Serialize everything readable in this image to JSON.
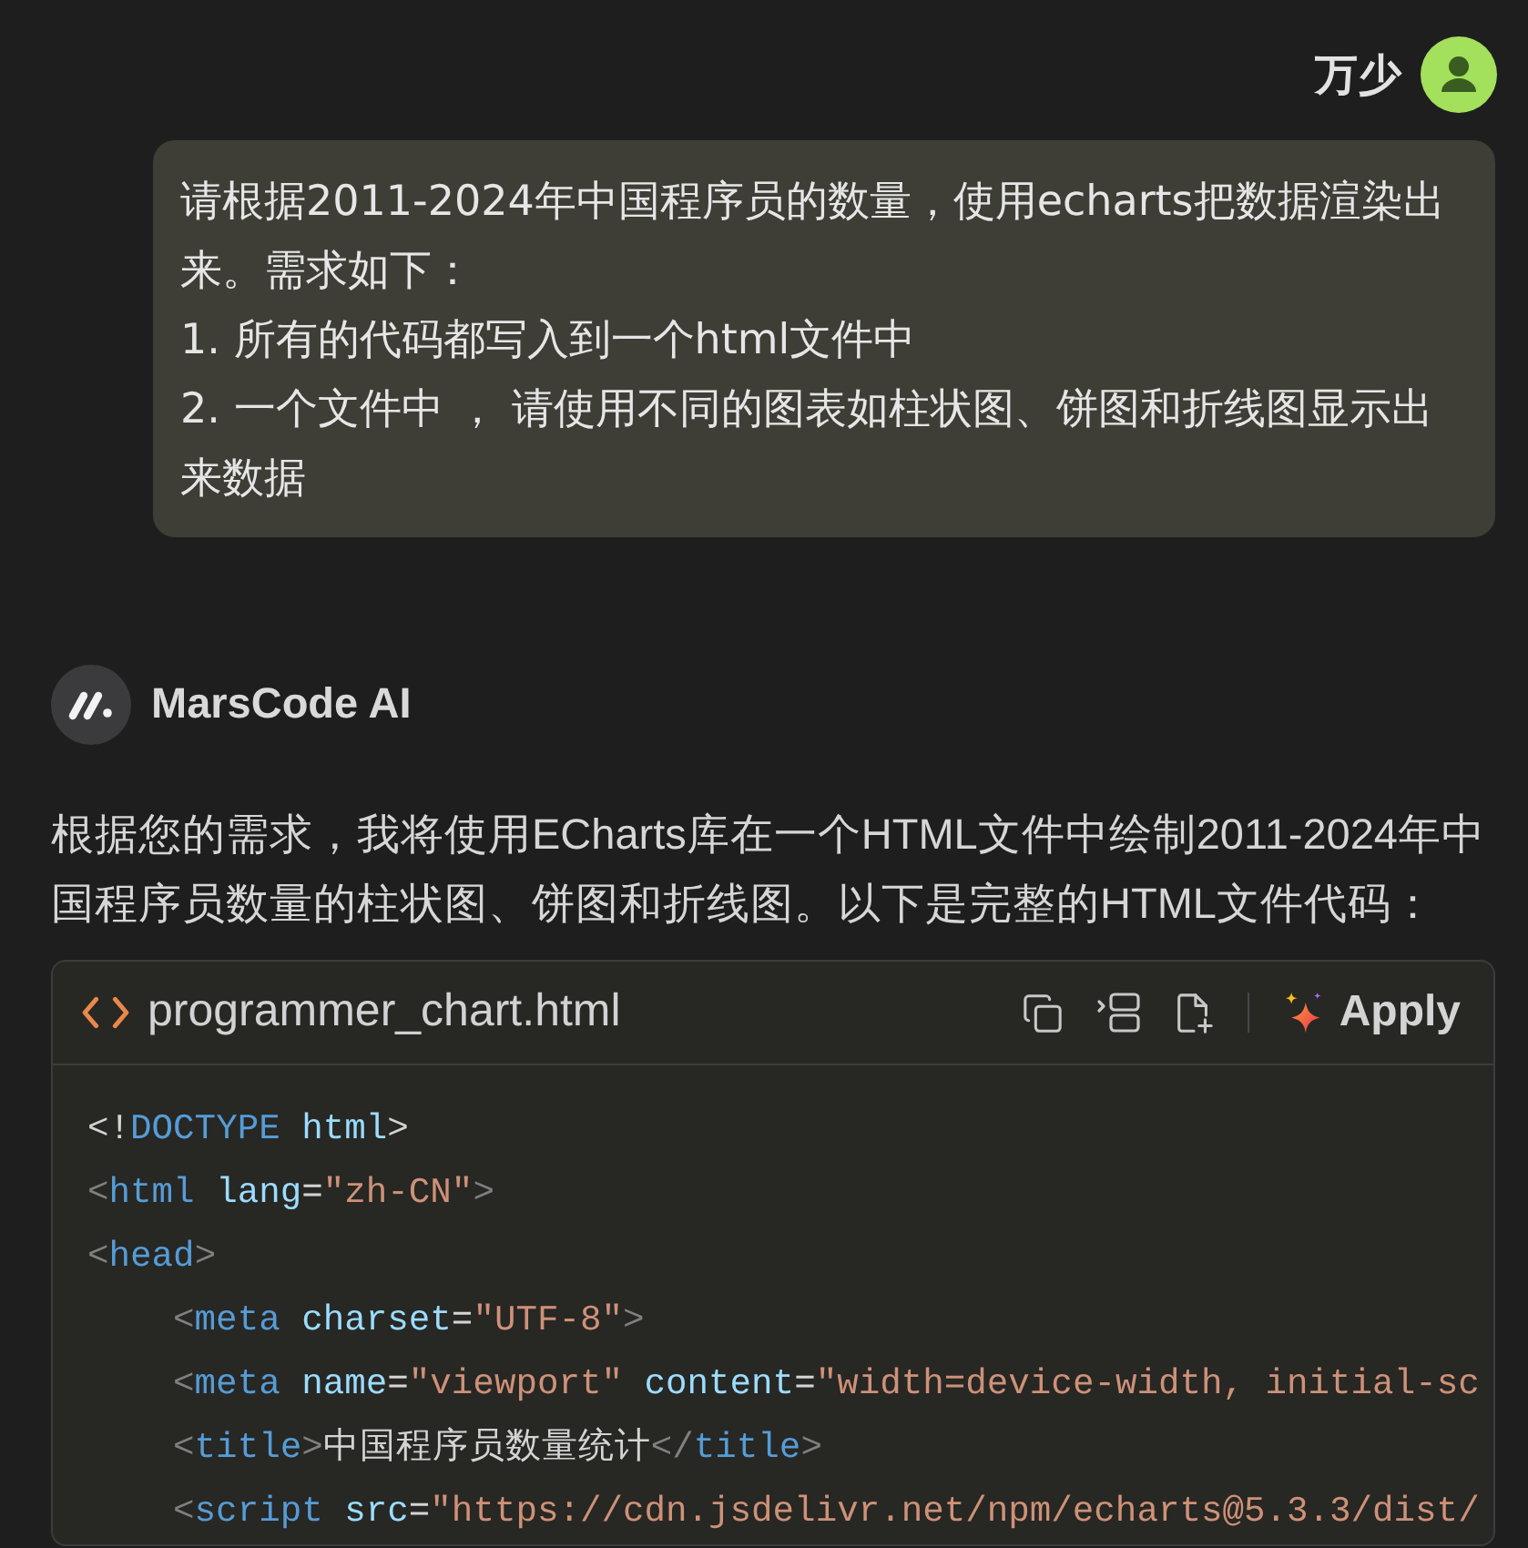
{
  "user_message": {
    "author": "万少",
    "paragraphs": [
      "请根据2011-2024年中国程序员的数量，使用echarts把数据渲染出来。需求如下：",
      "1. 所有的代码都写入到一个html文件中",
      "2. 一个文件中 ， 请使用不同的图表如柱状图、饼图和折线图显示出来数据"
    ]
  },
  "assistant_message": {
    "author": "MarsCode AI",
    "text": "根据您的需求，我将使用ECharts库在一个HTML文件中绘制2011-2024年中国程序员数量的柱状图、饼图和折线图。以下是完整的HTML文件代码：",
    "code_block": {
      "filename": "programmer_chart.html",
      "apply_label": "Apply",
      "lines": [
        {
          "tokens": [
            {
              "kind": "text",
              "text": "<!"
            },
            {
              "kind": "tag",
              "text": "DOCTYPE"
            },
            {
              "kind": "attr",
              "text": " html"
            },
            {
              "kind": "text",
              "text": ">"
            }
          ]
        },
        {
          "tokens": [
            {
              "kind": "punct",
              "text": "<"
            },
            {
              "kind": "tag",
              "text": "html"
            },
            {
              "kind": "attr",
              "text": " lang"
            },
            {
              "kind": "text",
              "text": "="
            },
            {
              "kind": "string",
              "text": "\"zh-CN\""
            },
            {
              "kind": "punct",
              "text": ">"
            }
          ]
        },
        {
          "tokens": [
            {
              "kind": "punct",
              "text": "<"
            },
            {
              "kind": "tag",
              "text": "head"
            },
            {
              "kind": "punct",
              "text": ">"
            }
          ],
          "children": [
            {
              "tokens": [
                {
                  "kind": "punct",
                  "text": "<"
                },
                {
                  "kind": "tag",
                  "text": "meta"
                },
                {
                  "kind": "attr",
                  "text": " charset"
                },
                {
                  "kind": "text",
                  "text": "="
                },
                {
                  "kind": "string",
                  "text": "\"UTF-8\""
                },
                {
                  "kind": "punct",
                  "text": ">"
                }
              ]
            },
            {
              "tokens": [
                {
                  "kind": "punct",
                  "text": "<"
                },
                {
                  "kind": "tag",
                  "text": "meta"
                },
                {
                  "kind": "attr",
                  "text": " name"
                },
                {
                  "kind": "text",
                  "text": "="
                },
                {
                  "kind": "string",
                  "text": "\"viewport\""
                },
                {
                  "kind": "attr",
                  "text": " content"
                },
                {
                  "kind": "text",
                  "text": "="
                },
                {
                  "kind": "string",
                  "text": "\"width=device-width, initial-sc"
                }
              ]
            },
            {
              "tokens": [
                {
                  "kind": "punct",
                  "text": "<"
                },
                {
                  "kind": "tag",
                  "text": "title"
                },
                {
                  "kind": "punct",
                  "text": ">"
                },
                {
                  "kind": "text",
                  "text": "中国程序员数量统计"
                },
                {
                  "kind": "punct",
                  "text": "</"
                },
                {
                  "kind": "tag",
                  "text": "title"
                },
                {
                  "kind": "punct",
                  "text": ">"
                }
              ]
            },
            {
              "tokens": [
                {
                  "kind": "punct",
                  "text": "<"
                },
                {
                  "kind": "tag",
                  "text": "script"
                },
                {
                  "kind": "attr",
                  "text": " src"
                },
                {
                  "kind": "text",
                  "text": "="
                },
                {
                  "kind": "string",
                  "text": "\"https://cdn.jsdelivr.net/npm/echarts@5.3.3/dist/"
                }
              ]
            }
          ]
        }
      ]
    }
  }
}
